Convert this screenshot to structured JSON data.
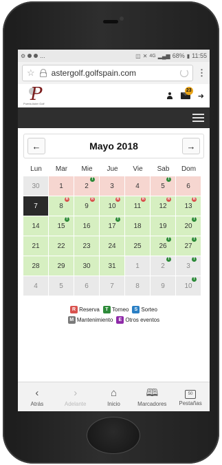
{
  "status_bar": {
    "left_text": "...",
    "network": "4G",
    "battery": "68%",
    "time": "11:55"
  },
  "browser": {
    "url": "astergolf.golfspain.com",
    "menu_glyph": "⋮"
  },
  "site": {
    "logo_text": "Puerta Aster Golf",
    "notification_count": "23"
  },
  "calendar": {
    "prev_glyph": "←",
    "next_glyph": "→",
    "month_title": "Mayo 2018",
    "weekdays": [
      "Lun",
      "Mar",
      "Mie",
      "Jue",
      "Vie",
      "Sab",
      "Dom"
    ],
    "weeks": [
      [
        {
          "day": "30",
          "bg": "grey"
        },
        {
          "day": "1",
          "bg": "pink"
        },
        {
          "day": "2",
          "bg": "pink",
          "marker": "T"
        },
        {
          "day": "3",
          "bg": "pink"
        },
        {
          "day": "4",
          "bg": "pink"
        },
        {
          "day": "5",
          "bg": "pink",
          "marker": "T"
        },
        {
          "day": "6",
          "bg": "pink"
        }
      ],
      [
        {
          "day": "7",
          "bg": "today"
        },
        {
          "day": "8",
          "bg": "green",
          "marker": "R"
        },
        {
          "day": "9",
          "bg": "green",
          "marker": "R"
        },
        {
          "day": "10",
          "bg": "green",
          "marker": "R"
        },
        {
          "day": "11",
          "bg": "green",
          "marker": "R"
        },
        {
          "day": "12",
          "bg": "green",
          "marker": "R"
        },
        {
          "day": "13",
          "bg": "green",
          "marker": "R"
        }
      ],
      [
        {
          "day": "14",
          "bg": "green"
        },
        {
          "day": "15",
          "bg": "green",
          "marker": "T"
        },
        {
          "day": "16",
          "bg": "green"
        },
        {
          "day": "17",
          "bg": "green",
          "marker": "T"
        },
        {
          "day": "18",
          "bg": "green"
        },
        {
          "day": "19",
          "bg": "green"
        },
        {
          "day": "20",
          "bg": "green",
          "marker": "T"
        }
      ],
      [
        {
          "day": "21",
          "bg": "green"
        },
        {
          "day": "22",
          "bg": "green"
        },
        {
          "day": "23",
          "bg": "green"
        },
        {
          "day": "24",
          "bg": "green"
        },
        {
          "day": "25",
          "bg": "green"
        },
        {
          "day": "26",
          "bg": "green",
          "marker": "T"
        },
        {
          "day": "27",
          "bg": "green",
          "marker": "T"
        }
      ],
      [
        {
          "day": "28",
          "bg": "green"
        },
        {
          "day": "29",
          "bg": "green"
        },
        {
          "day": "30",
          "bg": "green"
        },
        {
          "day": "31",
          "bg": "green"
        },
        {
          "day": "1",
          "bg": "grey"
        },
        {
          "day": "2",
          "bg": "grey",
          "marker": "T"
        },
        {
          "day": "3",
          "bg": "grey",
          "marker": "T"
        }
      ],
      [
        {
          "day": "4",
          "bg": "grey"
        },
        {
          "day": "5",
          "bg": "grey"
        },
        {
          "day": "6",
          "bg": "grey"
        },
        {
          "day": "7",
          "bg": "grey"
        },
        {
          "day": "8",
          "bg": "grey"
        },
        {
          "day": "9",
          "bg": "grey"
        },
        {
          "day": "10",
          "bg": "grey",
          "marker": "T"
        }
      ]
    ]
  },
  "legend": {
    "row1": [
      {
        "code": "R",
        "label": "Reserva",
        "color": "#d9534f"
      },
      {
        "code": "T",
        "label": "Torneo",
        "color": "#2e8b3a"
      },
      {
        "code": "S",
        "label": "Sorteo",
        "color": "#2a7fc4"
      }
    ],
    "row2": [
      {
        "code": "M",
        "label": "Mantenimiento",
        "color": "#7a7a7a"
      },
      {
        "code": "E",
        "label": "Otros eventos",
        "color": "#8e2aa8"
      }
    ]
  },
  "toolbar": {
    "back_glyph": "‹",
    "back_label": "Atrás",
    "forward_glyph": "›",
    "forward_label": "Adelante",
    "home_glyph": "⌂",
    "home_label": "Inicio",
    "bookmarks_glyph": "🕮",
    "bookmarks_label": "Marcadores",
    "tabs_count": "50",
    "tabs_label": "Pestañas"
  },
  "colors": {
    "reserva": "#d9534f",
    "torneo": "#2e8b3a",
    "sorteo": "#2a7fc4",
    "mantenimiento": "#7a7a7a",
    "otros": "#8e2aa8",
    "notification": "#e8a317"
  }
}
